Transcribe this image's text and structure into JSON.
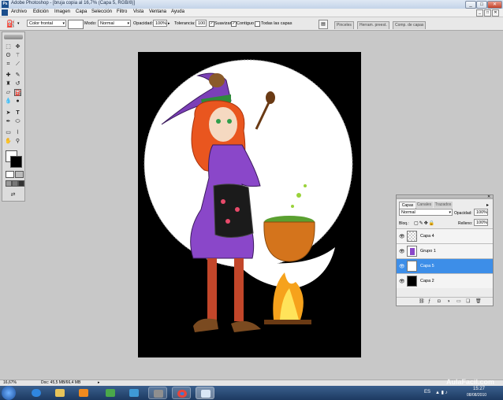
{
  "window": {
    "title": "Adobe Photoshop - [bruja copia al 16,7% (Capa 5, RGB/8)]",
    "app_icon": "photoshop-icon",
    "controls": [
      "_",
      "□",
      "✕"
    ]
  },
  "menu": {
    "items": [
      "Archivo",
      "Edición",
      "Imagen",
      "Capa",
      "Selección",
      "Filtro",
      "Vista",
      "Ventana",
      "Ayuda"
    ],
    "doc_controls": [
      "_",
      "□",
      "✕"
    ]
  },
  "options": {
    "fill_select": "Color frontal",
    "mode_label": "Modo:",
    "mode_value": "Normal",
    "opacity_label": "Opacidad:",
    "opacity_value": "100%",
    "tolerance_label": "Tolerancia:",
    "tolerance_value": "100",
    "smooth_label": "Suavizar",
    "contiguous_label": "Contiguo",
    "all_layers_label": "Todas las capas",
    "smooth_checked": true,
    "contiguous_checked": true,
    "all_layers_checked": false,
    "palette_tabs": [
      "Pinceles",
      "Herram. preest.",
      "Comp. de capas"
    ]
  },
  "layers_panel": {
    "tabs": [
      "Capas",
      "Canales",
      "Trazados"
    ],
    "blend_mode": "Normal",
    "opacity_label": "Opacidad:",
    "opacity_value": "100%",
    "lock_label": "Bloq.:",
    "fill_label": "Relleno:",
    "fill_value": "100%",
    "layers": [
      {
        "name": "Capa 4",
        "active": false
      },
      {
        "name": "Grupo 1",
        "active": false
      },
      {
        "name": "Capa 5",
        "active": true
      },
      {
        "name": "Capa 2",
        "active": false
      }
    ]
  },
  "status": {
    "zoom": "16,67%",
    "doc_info": "Doc: 45,5 MB/66,4 MB"
  },
  "taskbar": {
    "language": "ES",
    "time": "15:27",
    "date": "08/08/2010",
    "watermark": "AulaFacil.com"
  },
  "colors": {
    "selected_layer": "#3d8ee8",
    "taskbar": "#1d3a61",
    "canvas_bg": "#000000"
  }
}
